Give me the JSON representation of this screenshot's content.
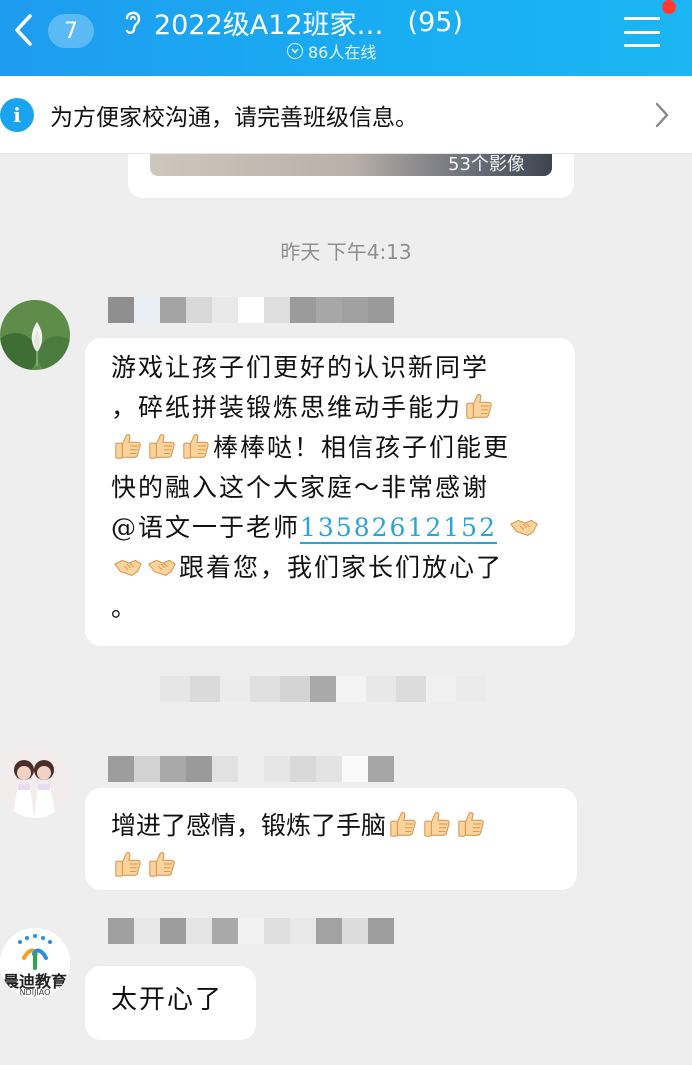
{
  "header": {
    "unread_count": "7",
    "title": "2022级A12班家…",
    "member_count": "(95)",
    "online_text": "86人在线"
  },
  "notice": {
    "text": "为方便家校沟通，请完善班级信息。"
  },
  "previous_card": {
    "media_count": "53个影像"
  },
  "timestamp": "昨天 下午4:13",
  "messages": [
    {
      "lines": [
        "游戏让孩子们更好的认识新同学",
        "，碎纸拼装锻炼思维动手能力",
        "棒棒哒！相信孩子们能更",
        "快的融入这个大家庭～非常感谢",
        "@语文一于老师",
        "13582612152",
        "跟着您，我们家长们放心了",
        "。"
      ]
    },
    {
      "lines": [
        "增进了感情，锻炼了手脑"
      ]
    },
    {
      "lines": [
        "太开心了"
      ]
    }
  ],
  "avatars": {
    "third_logo_text": "晨迪教育",
    "third_logo_sub": "NDIJIAO"
  },
  "icons": {
    "back": "chevron-left-icon",
    "ear": "ear-icon",
    "online": "chevron-down-circle-icon",
    "menu": "menu-icon",
    "info": "info-icon",
    "arrow": "chevron-right-icon",
    "thumbs_up": "thumbs-up-emoji",
    "handshake": "handshake-emoji"
  },
  "colors": {
    "header_start": "#1e9cf0",
    "header_end": "#1bb6f3",
    "mention": "#2aa3d6",
    "badge_red": "#ff3b30"
  }
}
